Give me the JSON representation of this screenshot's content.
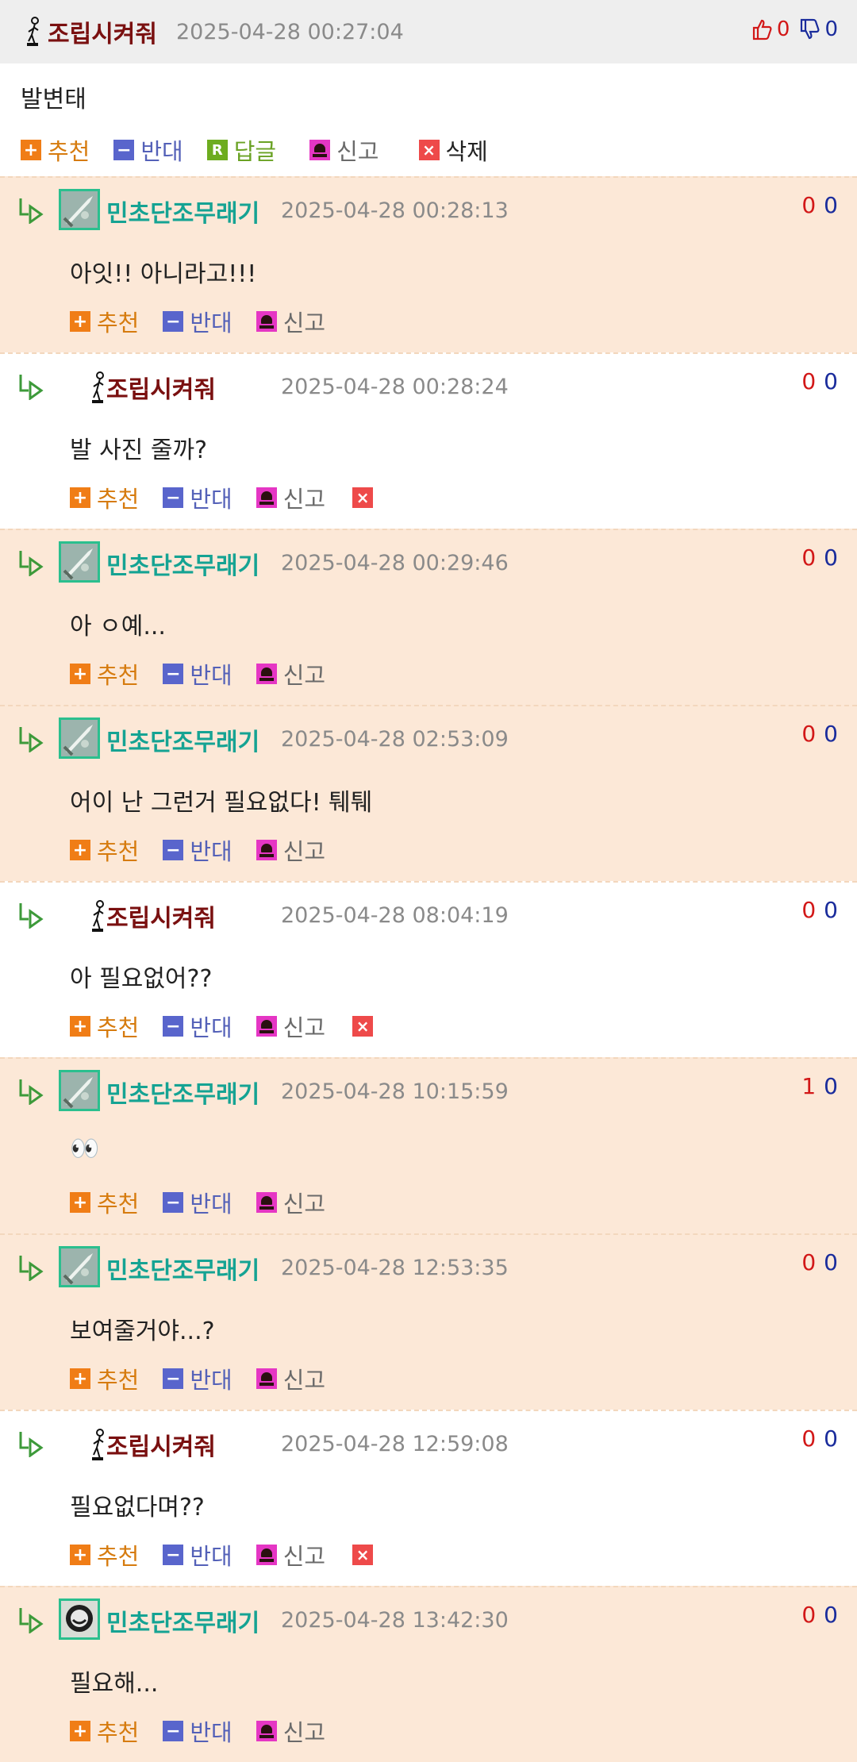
{
  "post": {
    "nick": "조립시켜줘",
    "time": "2025-04-28 00:27:04",
    "up": "0",
    "down": "0",
    "body": "발변태",
    "actions": {
      "recommend": "추천",
      "oppose": "반대",
      "reply": "답글",
      "report": "신고",
      "delete": "삭제"
    }
  },
  "labels": {
    "recommend": "추천",
    "oppose": "반대",
    "report": "신고"
  },
  "comments": [
    {
      "nick": "민초단조무래기",
      "time": "2025-04-28 00:28:13",
      "up": "0",
      "down": "0",
      "text": "아잇!! 아니라고!!!",
      "bg": "orange",
      "avatar": "sword",
      "deletable": false
    },
    {
      "nick": "조립시켜줘",
      "time": "2025-04-28 00:28:24",
      "up": "0",
      "down": "0",
      "text": "발 사진 줄까?",
      "bg": "white",
      "avatar": "stick",
      "deletable": true
    },
    {
      "nick": "민초단조무래기",
      "time": "2025-04-28 00:29:46",
      "up": "0",
      "down": "0",
      "text": "아 ㅇ예...",
      "bg": "orange",
      "avatar": "sword",
      "deletable": false
    },
    {
      "nick": "민초단조무래기",
      "time": "2025-04-28 02:53:09",
      "up": "0",
      "down": "0",
      "text": "어이 난 그런거 필요없다! 퉤퉤",
      "bg": "orange",
      "avatar": "sword",
      "deletable": false
    },
    {
      "nick": "조립시켜줘",
      "time": "2025-04-28 08:04:19",
      "up": "0",
      "down": "0",
      "text": "아 필요없어??",
      "bg": "white",
      "avatar": "stick",
      "deletable": true
    },
    {
      "nick": "민초단조무래기",
      "time": "2025-04-28 10:15:59",
      "up": "1",
      "down": "0",
      "text": "👀",
      "bg": "orange",
      "avatar": "sword",
      "deletable": false
    },
    {
      "nick": "민초단조무래기",
      "time": "2025-04-28 12:53:35",
      "up": "0",
      "down": "0",
      "text": "보여줄거야...?",
      "bg": "orange",
      "avatar": "sword",
      "deletable": false
    },
    {
      "nick": "조립시켜줘",
      "time": "2025-04-28 12:59:08",
      "up": "0",
      "down": "0",
      "text": "필요없다며??",
      "bg": "white",
      "avatar": "stick",
      "deletable": true
    },
    {
      "nick": "민초단조무래기",
      "time": "2025-04-28 13:42:30",
      "up": "0",
      "down": "0",
      "text": "필요해...",
      "bg": "orange",
      "avatar": "face",
      "deletable": false
    }
  ]
}
